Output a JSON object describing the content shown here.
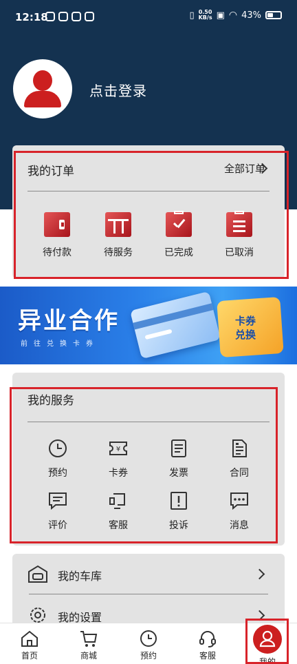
{
  "status_bar": {
    "time": "12:18",
    "net_speed": "0.50\nKB/s",
    "battery": "43%"
  },
  "profile": {
    "login_label": "点击登录"
  },
  "orders": {
    "title": "我的订单",
    "all_label": "全部订单",
    "items": [
      {
        "label": "待付款",
        "icon": "wallet-icon"
      },
      {
        "label": "待服务",
        "icon": "service-pending-icon"
      },
      {
        "label": "已完成",
        "icon": "clipboard-check-icon"
      },
      {
        "label": "已取消",
        "icon": "clipboard-cancel-icon"
      }
    ]
  },
  "banner": {
    "title": "异业合作",
    "subtitle": "前往兑换卡券",
    "badge": "卡券\n兑换"
  },
  "services": {
    "title": "我的服务",
    "items": [
      {
        "label": "预约",
        "icon": "clock-icon"
      },
      {
        "label": "卡券",
        "icon": "ticket-icon"
      },
      {
        "label": "发票",
        "icon": "invoice-icon"
      },
      {
        "label": "合同",
        "icon": "contract-icon"
      },
      {
        "label": "评价",
        "icon": "comment-icon"
      },
      {
        "label": "客服",
        "icon": "customer-service-icon"
      },
      {
        "label": "投诉",
        "icon": "complaint-icon"
      },
      {
        "label": "消息",
        "icon": "message-icon"
      }
    ]
  },
  "list": {
    "garage": "我的车库",
    "settings": "我的设置"
  },
  "bottom_nav": {
    "items": [
      {
        "label": "首页",
        "icon": "home-icon"
      },
      {
        "label": "商城",
        "icon": "cart-icon"
      },
      {
        "label": "预约",
        "icon": "clock-icon"
      },
      {
        "label": "客服",
        "icon": "headset-icon"
      },
      {
        "label": "我的",
        "icon": "user-icon"
      }
    ],
    "active_color": "#cc1f1f"
  },
  "colors": {
    "header_bg": "#143250",
    "accent_red": "#d8232a",
    "card_bg": "#e3e3e3"
  }
}
